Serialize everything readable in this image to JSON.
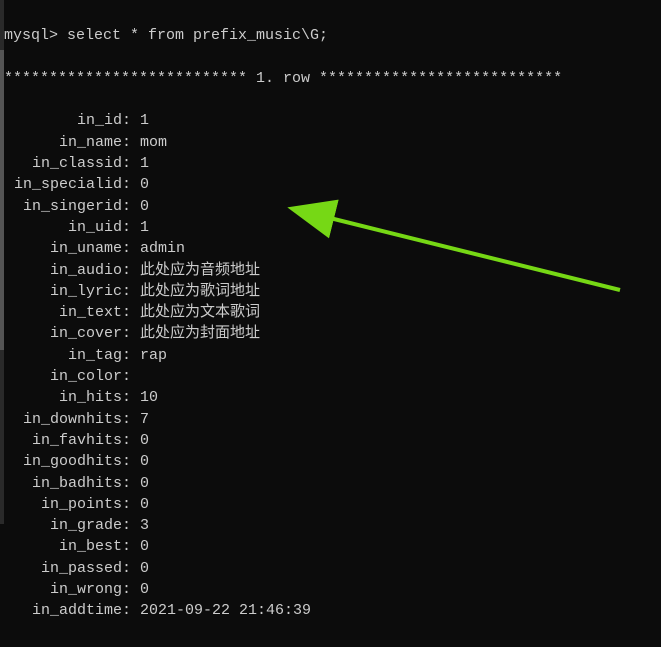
{
  "prompt": "mysql> select * from prefix_music\\G;",
  "separator": "*************************** 1. row ***************************",
  "rows": [
    {
      "name": "in_id",
      "value": "1"
    },
    {
      "name": "in_name",
      "value": "mom"
    },
    {
      "name": "in_classid",
      "value": "1"
    },
    {
      "name": "in_specialid",
      "value": "0"
    },
    {
      "name": "in_singerid",
      "value": "0"
    },
    {
      "name": "in_uid",
      "value": "1"
    },
    {
      "name": "in_uname",
      "value": "admin"
    },
    {
      "name": "in_audio",
      "value": "此处应为音频地址"
    },
    {
      "name": "in_lyric",
      "value": "此处应为歌词地址"
    },
    {
      "name": "in_text",
      "value": "此处应为文本歌词"
    },
    {
      "name": "in_cover",
      "value": "此处应为封面地址"
    },
    {
      "name": "in_tag",
      "value": "rap"
    },
    {
      "name": "in_color",
      "value": ""
    },
    {
      "name": "in_hits",
      "value": "10"
    },
    {
      "name": "in_downhits",
      "value": "7"
    },
    {
      "name": "in_favhits",
      "value": "0"
    },
    {
      "name": "in_goodhits",
      "value": "0"
    },
    {
      "name": "in_badhits",
      "value": "0"
    },
    {
      "name": "in_points",
      "value": "0"
    },
    {
      "name": "in_grade",
      "value": "3"
    },
    {
      "name": "in_best",
      "value": "0"
    },
    {
      "name": "in_passed",
      "value": "0"
    },
    {
      "name": "in_wrong",
      "value": "0"
    },
    {
      "name": "in_addtime",
      "value": "2021-09-22 21:46:39"
    }
  ],
  "annotation": {
    "arrow_color": "#76d815"
  }
}
